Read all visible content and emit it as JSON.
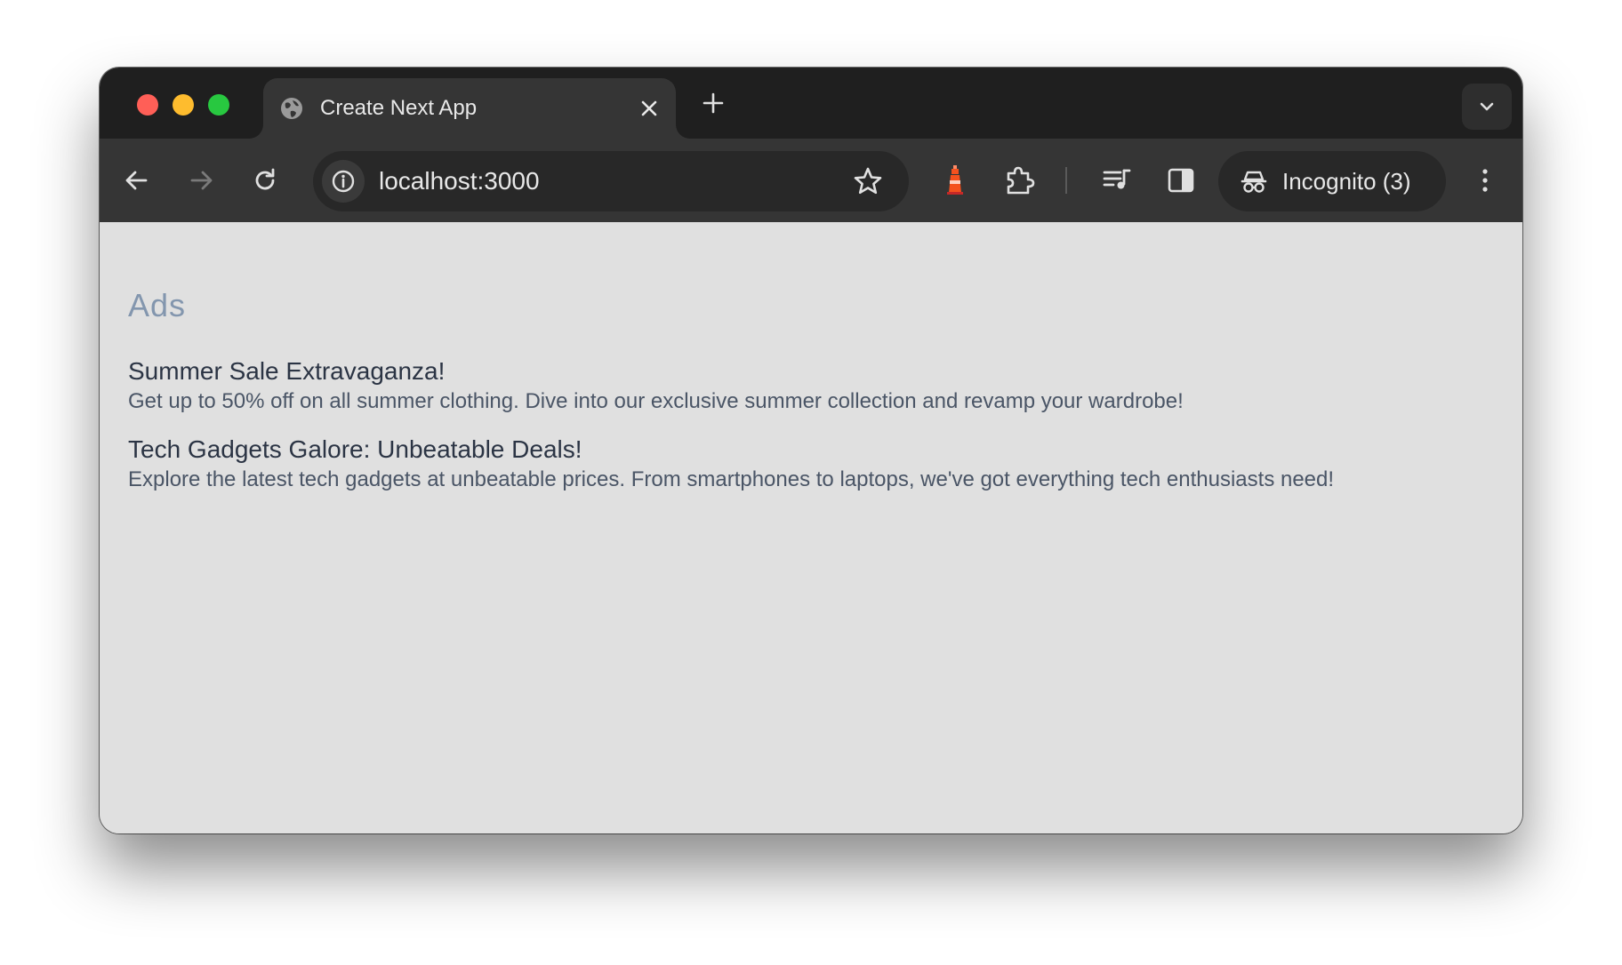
{
  "browser": {
    "tab": {
      "title": "Create Next App",
      "favicon_icon": "globe-icon",
      "close_icon": "close-icon"
    },
    "new_tab_icon": "plus-icon",
    "tab_search_icon": "chevron-down-icon",
    "toolbar": {
      "back_icon": "arrow-left-icon",
      "forward_icon": "arrow-right-icon",
      "reload_icon": "reload-icon",
      "url": "localhost:3000",
      "site_info_icon": "info-icon",
      "bookmark_icon": "star-icon",
      "extension_lighthouse_icon": "lighthouse-icon",
      "extensions_icon": "puzzle-icon",
      "media_icon": "media-queue-icon",
      "side_panel_icon": "side-panel-icon",
      "incognito_label": "Incognito (3)",
      "incognito_icon": "incognito-icon",
      "menu_icon": "kebab-menu-icon"
    },
    "colors": {
      "tabstrip_bg": "#1f1f1f",
      "toolbar_bg": "#353535",
      "traffic_red": "#ff5f57",
      "traffic_yellow": "#febc2e",
      "traffic_green": "#28c840",
      "lighthouse_orange": "#f4511e"
    }
  },
  "page": {
    "heading": "Ads",
    "background": "#e0e0e0",
    "heading_color": "#8396ae",
    "ads": [
      {
        "title": "Summer Sale Extravaganza!",
        "description": "Get up to 50% off on all summer clothing. Dive into our exclusive summer collection and revamp your wardrobe!"
      },
      {
        "title": "Tech Gadgets Galore: Unbeatable Deals!",
        "description": "Explore the latest tech gadgets at unbeatable prices. From smartphones to laptops, we've got everything tech enthusiasts need!"
      }
    ]
  }
}
